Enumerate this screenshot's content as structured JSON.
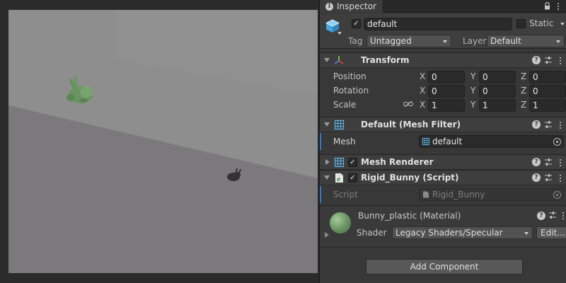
{
  "inspector": {
    "tab_label": "Inspector"
  },
  "gameobject": {
    "name": "default",
    "active": true,
    "static_label": "Static",
    "static_checked": false,
    "tag_label": "Tag",
    "tag_value": "Untagged",
    "layer_label": "Layer",
    "layer_value": "Default"
  },
  "transform": {
    "title": "Transform",
    "position_label": "Position",
    "rotation_label": "Rotation",
    "scale_label": "Scale",
    "axis_x": "X",
    "axis_y": "Y",
    "axis_z": "Z",
    "position": {
      "x": "0",
      "y": "0",
      "z": "0"
    },
    "rotation": {
      "x": "0",
      "y": "0",
      "z": "0"
    },
    "scale": {
      "x": "1",
      "y": "1",
      "z": "1"
    }
  },
  "mesh_filter": {
    "title": "Default (Mesh Filter)",
    "mesh_label": "Mesh",
    "mesh_value": "default"
  },
  "mesh_renderer": {
    "title": "Mesh Renderer",
    "enabled": true
  },
  "script_component": {
    "title": "Rigid_Bunny (Script)",
    "enabled": true,
    "script_label": "Script",
    "script_value": "Rigid_Bunny"
  },
  "material": {
    "name": "Bunny_plastic (Material)",
    "shader_label": "Shader",
    "shader_value": "Legacy Shaders/Specular",
    "edit_label": "Edit...",
    "color": "#6f9b68"
  },
  "add_component_label": "Add Component",
  "colors": {
    "accent": "#3a79bb",
    "panel": "#383838",
    "scene_background": "#8f8e8f",
    "scene_floor": "#7b797b"
  }
}
